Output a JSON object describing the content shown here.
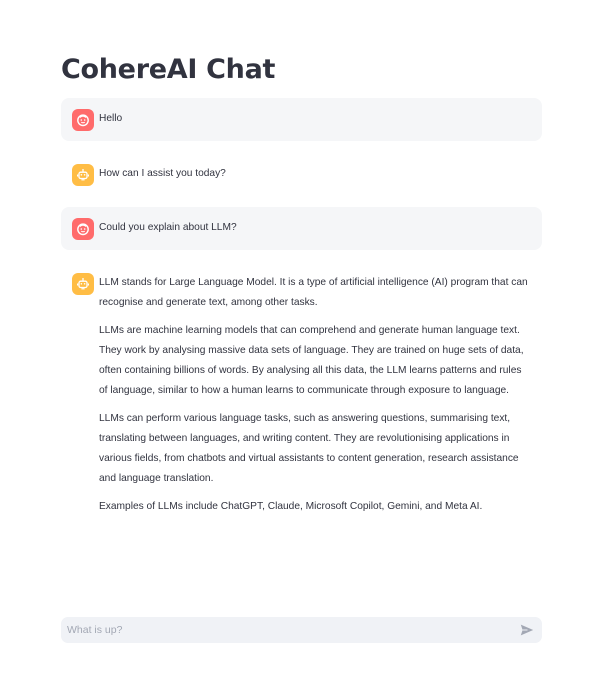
{
  "app": {
    "title": "CohereAI Chat"
  },
  "colors": {
    "user_avatar": "#ff6b6b",
    "assistant_avatar": "#ffbd45",
    "user_bubble": "#f5f6f8",
    "input_bg": "#f0f2f6"
  },
  "messages": [
    {
      "role": "user",
      "avatar_icon": "user-face-icon",
      "paragraphs": [
        "Hello"
      ]
    },
    {
      "role": "assistant",
      "avatar_icon": "robot-icon",
      "paragraphs": [
        "How can I assist you today?"
      ]
    },
    {
      "role": "user",
      "avatar_icon": "user-face-icon",
      "paragraphs": [
        "Could you explain about LLM?"
      ]
    },
    {
      "role": "assistant",
      "avatar_icon": "robot-icon",
      "paragraphs": [
        "LLM stands for Large Language Model. It is a type of artificial intelligence (AI) program that can recognise and generate text, among other tasks.",
        "LLMs are machine learning models that can comprehend and generate human language text. They work by analysing massive data sets of language. They are trained on huge sets of data, often containing billions of words. By analysing all this data, the LLM learns patterns and rules of language, similar to how a human learns to communicate through exposure to language.",
        "LLMs can perform various language tasks, such as answering questions, summarising text, translating between languages, and writing content. They are revolutionising applications in various fields, from chatbots and virtual assistants to content generation, research assistance and language translation.",
        "Examples of LLMs include ChatGPT, Claude, Microsoft Copilot, Gemini, and Meta AI."
      ]
    }
  ],
  "composer": {
    "placeholder": "What is up?",
    "value": "",
    "send_icon": "send-icon"
  }
}
